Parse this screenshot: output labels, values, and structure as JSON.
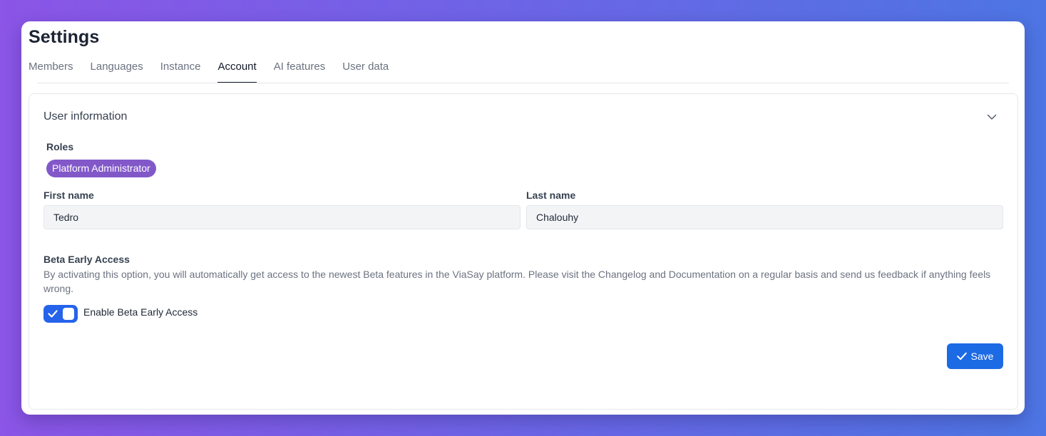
{
  "page": {
    "title": "Settings"
  },
  "tabs": [
    {
      "label": "Members",
      "active": false
    },
    {
      "label": "Languages",
      "active": false
    },
    {
      "label": "Instance",
      "active": false
    },
    {
      "label": "Account",
      "active": true
    },
    {
      "label": "AI features",
      "active": false
    },
    {
      "label": "User data",
      "active": false
    }
  ],
  "user_info": {
    "title": "User information",
    "roles_label": "Roles",
    "role": "Platform Administrator",
    "first_name_label": "First name",
    "first_name_value": "Tedro",
    "last_name_label": "Last name",
    "last_name_value": "Chalouhy"
  },
  "beta": {
    "title": "Beta Early Access",
    "description": "By activating this option, you will automatically get access to the newest Beta features in the ViaSay platform. Please visit the Changelog and Documentation on a regular basis and send us feedback if anything feels wrong.",
    "toggle_label": "Enable Beta Early Access",
    "enabled": true
  },
  "actions": {
    "save_label": "Save"
  },
  "icons": {
    "chevron": "chevron-down-icon",
    "toggle_check": "check-icon",
    "save": "check-icon"
  },
  "colors": {
    "accent": "#1d6ae5",
    "role_pill": "#8258c9",
    "toggle_on": "#2563eb"
  }
}
